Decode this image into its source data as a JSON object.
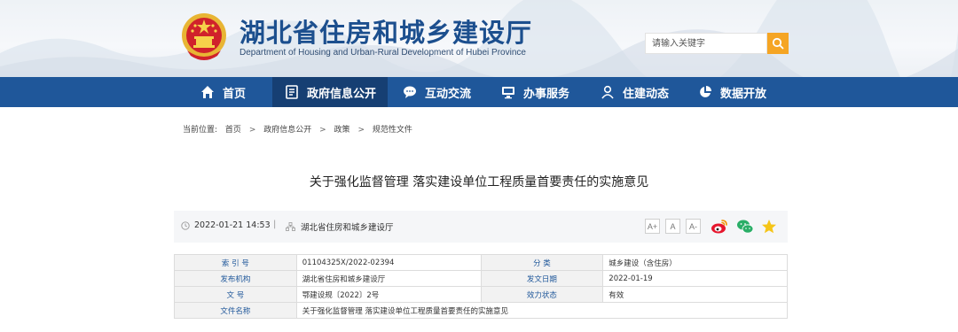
{
  "header": {
    "site_title": "湖北省住房和城乡建设厅",
    "site_subtitle": "Department of Housing and Urban-Rural Development of Hubei Province",
    "search_placeholder": "请输入关键字",
    "search_icon": "search-icon",
    "colors": {
      "title": "#1c4f8e",
      "search_button": "#f5a524"
    }
  },
  "nav": {
    "background": "#1f579a",
    "items": [
      {
        "label": "首页",
        "icon": "home-icon"
      },
      {
        "label": "政府信息公开",
        "icon": "document-icon",
        "active": true
      },
      {
        "label": "互动交流",
        "icon": "chat-icon"
      },
      {
        "label": "办事服务",
        "icon": "monitor-icon"
      },
      {
        "label": "住建动态",
        "icon": "person-icon"
      },
      {
        "label": "数据开放",
        "icon": "pie-chart-icon"
      }
    ]
  },
  "breadcrumb": {
    "prefix": "当前位置:",
    "items": [
      "首页",
      "政府信息公开",
      "政策",
      "规范性文件"
    ],
    "separator": ">"
  },
  "article": {
    "title": "关于强化监督管理 落实建设单位工程质量首要责任的实施意见",
    "date": "2022-01-21 14:53",
    "divider": "|",
    "source": "湖北省住房和城乡建设厅",
    "font_buttons": [
      "A+",
      "A",
      "A-"
    ],
    "share_icons": [
      "weibo-icon",
      "wechat-icon",
      "favorite-star-icon"
    ]
  },
  "info_table": {
    "rows": [
      [
        "索 引 号",
        "01104325X/2022-02394",
        "分 类",
        "城乡建设（含住房）"
      ],
      [
        "发布机构",
        "湖北省住房和城乡建设厅",
        "发文日期",
        "2022-01-19"
      ],
      [
        "文 号",
        "鄂建设规〔2022〕2号",
        "效力状态",
        "有效"
      ],
      [
        "文件名称",
        "关于强化监督管理 落实建设单位工程质量首要责任的实施意见"
      ]
    ]
  }
}
